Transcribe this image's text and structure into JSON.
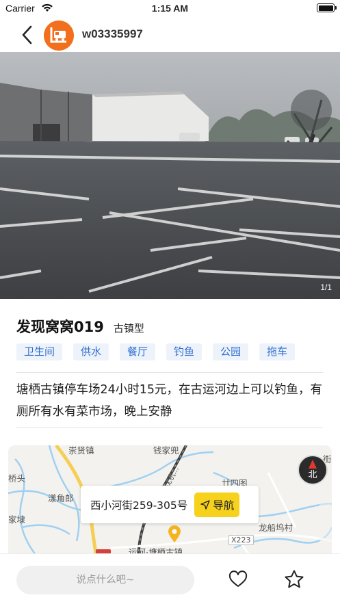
{
  "status_bar": {
    "carrier": "Carrier",
    "time": "1:15 AM"
  },
  "header": {
    "username": "w03335997",
    "avatar_color": "#f2701d",
    "back_icon": "chevron-left-icon"
  },
  "photo": {
    "counter": "1/1"
  },
  "spot": {
    "title": "发现窝窝019",
    "type": "古镇型",
    "tags": [
      "卫生间",
      "供水",
      "餐厅",
      "钓鱼",
      "公园",
      "拖车"
    ],
    "description": "塘栖古镇停车场24小时15元，在古运河边上可以钓鱼，有厕所有水有菜市场，晚上安静"
  },
  "map": {
    "labels": {
      "town_top": "崇贤镇",
      "qianjiadou": "钱家兜",
      "qiaotou": "桥头",
      "yangjiaolang": "漾角郎",
      "jiadai": "家埭",
      "nianxi": "廿四图",
      "longchuanwu": "龙船坞村",
      "highway": "沈杭...",
      "road_x223": "X223",
      "tangqi": "运河·塘栖古镇",
      "right_edge": "街"
    },
    "compass_label": "北",
    "address": "西小河街259-305号",
    "navigate_label": "导航"
  },
  "bottom_bar": {
    "comment_placeholder": "说点什么吧~",
    "like_icon": "heart-icon",
    "favorite_icon": "star-icon"
  },
  "colors": {
    "tag_bg": "#eef3fb",
    "tag_text": "#2f6fcf",
    "nav_button": "#f7d21c"
  }
}
